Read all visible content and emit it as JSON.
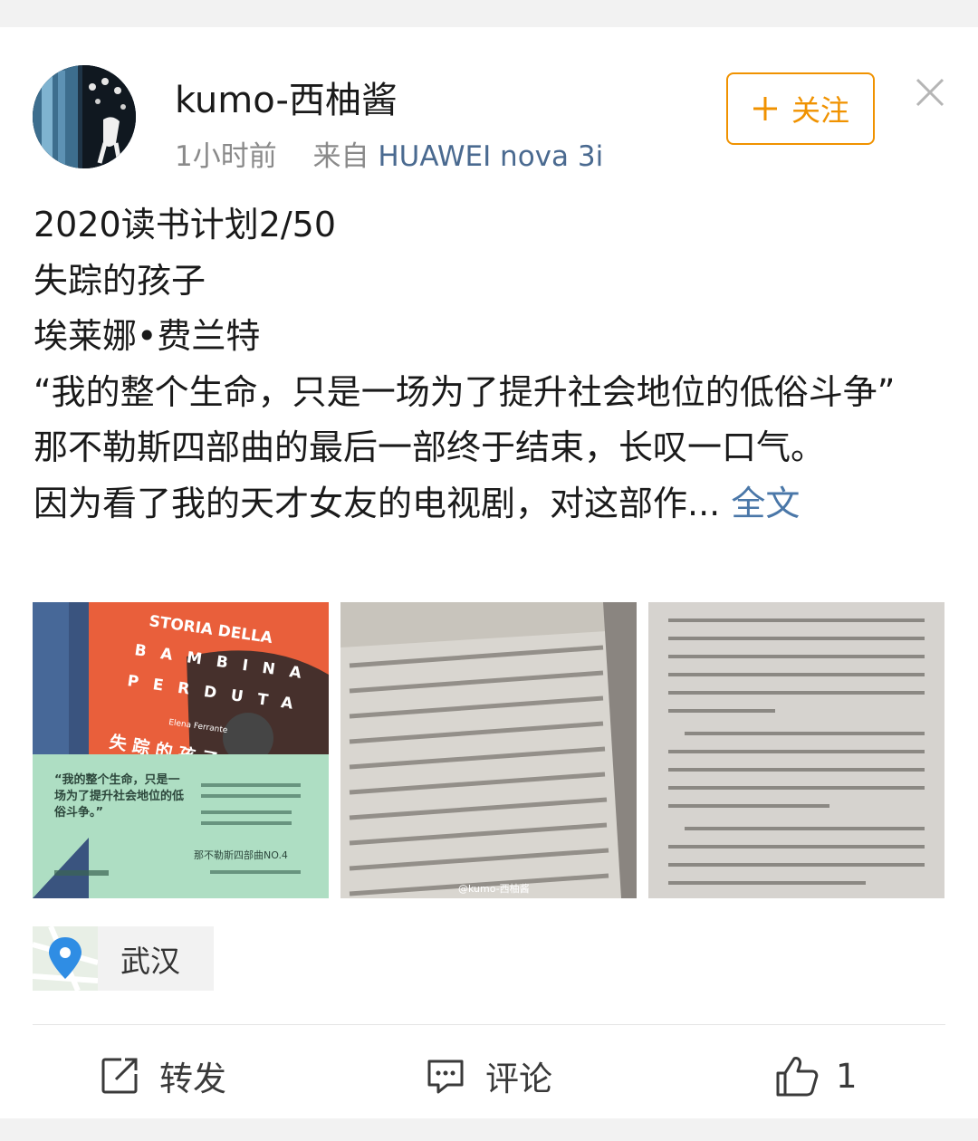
{
  "post": {
    "username": "kumo-西柚酱",
    "time": "1小时前",
    "source_prefix": "来自",
    "device": "HUAWEI nova 3i",
    "follow_label": "关注",
    "text_lines": [
      "2020读书计划2/50",
      "失踪的孩子",
      "埃莱娜•费兰特",
      "“我的整个生命，只是一场为了提升社会地位的低俗斗争”",
      "那不勒斯四部曲的最后一部终于结束，长叹一口气。"
    ],
    "last_line": "因为看了我的天才女友的电视剧，对这部作...",
    "fulltext_link": "全文",
    "book_cover": {
      "title_lines": [
        "STORIA DELLA",
        "BAMBINA",
        "PERDUTA"
      ],
      "author": "Elena Ferrante",
      "chinese_title": "失 踪 的 孩 子",
      "quote": "“我的整个生命，只是一场为了提升社会地位的低俗斗争。”",
      "series": "那不勒斯四部曲NO.4"
    },
    "watermark": "@kumo-西柚酱",
    "location": "武汉"
  },
  "actions": {
    "repost": "转发",
    "comment": "评论",
    "likes": "1"
  },
  "colors": {
    "accent_orange": "#f09200",
    "link_blue": "#4a77a8",
    "cover_orange": "#e8552f",
    "cover_mint": "#a9dcc0"
  }
}
